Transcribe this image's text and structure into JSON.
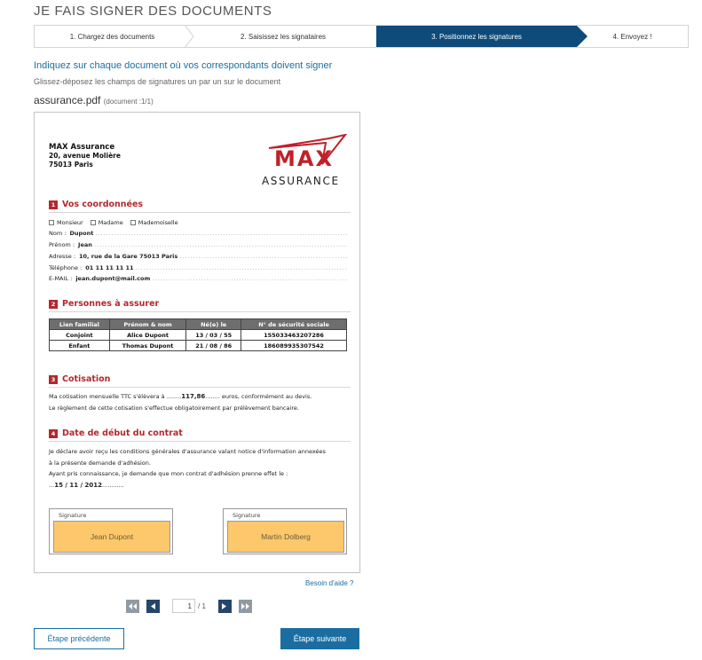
{
  "header": {
    "title": "JE FAIS SIGNER DES DOCUMENTS"
  },
  "steps": [
    {
      "label": "1. Chargez des documents",
      "active": false
    },
    {
      "label": "2. Saisissez les signataires",
      "active": false
    },
    {
      "label": "3. Positionnez les signatures",
      "active": true
    },
    {
      "label": "4. Envoyez !",
      "active": false
    }
  ],
  "instructions": {
    "line1": "Indiquez sur chaque document où vos correspondants doivent signer",
    "line2": "Glissez-déposez les champs de signatures un par un sur le document"
  },
  "document": {
    "filename": "assurance.pdf",
    "counter": "(document :1/1)",
    "company": {
      "name": "MAX Assurance",
      "address1": "20, avenue Molière",
      "address2": "75013 Paris"
    },
    "logo": {
      "top": "MAX",
      "bottom": "ASSURANCE",
      "color": "#c0202a"
    },
    "sections": {
      "s1": {
        "num": "1",
        "title": "Vos coordonnées"
      },
      "s2": {
        "num": "2",
        "title": "Personnes à assurer"
      },
      "s3": {
        "num": "3",
        "title": "Cotisation"
      },
      "s4": {
        "num": "4",
        "title": "Date de début du contrat"
      }
    },
    "civility": [
      "Monsieur",
      "Madame",
      "Mademoiselle"
    ],
    "fields": {
      "nom": {
        "label": "Nom  :",
        "value": "Dupont"
      },
      "prenom": {
        "label": "Prénom  :",
        "value": "Jean"
      },
      "adresse": {
        "label": "Adresse  :",
        "value": "10, rue de la Gare 75013 Paris"
      },
      "telephone": {
        "label": "Téléphone  :",
        "value": "01 11 11 11 11"
      },
      "email": {
        "label": "E-MAIL  :",
        "value": "jean.dupont@mail.com"
      }
    },
    "persons_table": {
      "headers": [
        "Lien familial",
        "Prénom & nom",
        "Né(e) le",
        "N° de sécurité sociale"
      ],
      "rows": [
        [
          "Conjoint",
          "Alice Dupont",
          "13 / 03 / 55",
          "155033463207286"
        ],
        [
          "Enfant",
          "Thomas Dupont",
          "21 / 08 / 86",
          "186089935307542"
        ]
      ]
    },
    "cotisation": {
      "line1_before": "Ma cotisation mensuelle TTC s'élèvera à ........",
      "amount": "117,86",
      "line1_after": "........ euros, conformément au devis.",
      "line2": "Le règlement de cette cotisation s'effectue obligatoirement par prélèvement bancaire."
    },
    "debut": {
      "line1": "Je déclare avoir reçu les conditions générales d'assurance valant notice d'information annexées",
      "line2": "à la présente demande d'adhésion.",
      "line3": "Ayant pris connaissance, je demande que mon contrat d'adhésion prenne effet le :",
      "date_prefix": "...",
      "date": "15 / 11 / 2012",
      "date_suffix": "............"
    },
    "signatures": [
      {
        "label": "Signature",
        "name": "Jean Dupont"
      },
      {
        "label": "Signature",
        "name": "Martin Dolberg"
      }
    ]
  },
  "help_link": "Besoin d'aide ?",
  "pager": {
    "current": "1",
    "total": "/ 1"
  },
  "buttons": {
    "prev": "Étape précédente",
    "next": "Étape suivante"
  },
  "colors": {
    "primary": "#1b6da1",
    "active_step": "#0e4a7a",
    "signature_field": "#fdc86c",
    "section_red": "#b3282d"
  }
}
